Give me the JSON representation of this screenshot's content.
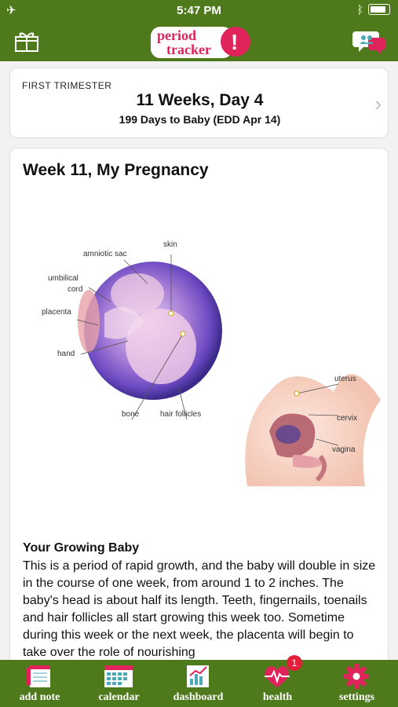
{
  "status_bar": {
    "time": "5:47 PM"
  },
  "header": {
    "logo_line1": "period",
    "logo_line2": "tracker",
    "logo_mark": "!"
  },
  "summary": {
    "trimester": "FIRST TRIMESTER",
    "weeks_day": "11 Weeks, Day 4",
    "days_to_baby": "199 Days to Baby (EDD Apr 14)"
  },
  "article": {
    "title": "Week 11, My Pregnancy",
    "illustration_labels": {
      "skin": "skin",
      "amniotic_sac": "amniotic sac",
      "umbilical": "umbilical",
      "cord": "cord",
      "placenta": "placenta",
      "hand": "hand",
      "bone": "bone",
      "hair_follicles": "hair follicles",
      "uterus": "uterus",
      "cervix": "cervix",
      "vagina": "vagina"
    },
    "section_title": "Your Growing Baby",
    "section_text": "This is a period of rapid growth, and the baby will double in size in the course of one week, from around 1 to 2 inches. The baby's head is about half its length. Teeth, fingernails, toenails and hair follicles all start growing this week too. Sometime during this week or the next week, the placenta will begin to take over the role of nourishing"
  },
  "tabs": [
    {
      "label": "add note",
      "icon": "notebook-icon"
    },
    {
      "label": "calendar",
      "icon": "calendar-icon"
    },
    {
      "label": "dashboard",
      "icon": "chart-icon"
    },
    {
      "label": "health",
      "icon": "heartbeat-icon",
      "badge": "1"
    },
    {
      "label": "settings",
      "icon": "gear-icon"
    }
  ],
  "colors": {
    "header_green": "#4e7a1c",
    "logo_pink": "#e0235a",
    "badge_red": "#e0203a"
  }
}
